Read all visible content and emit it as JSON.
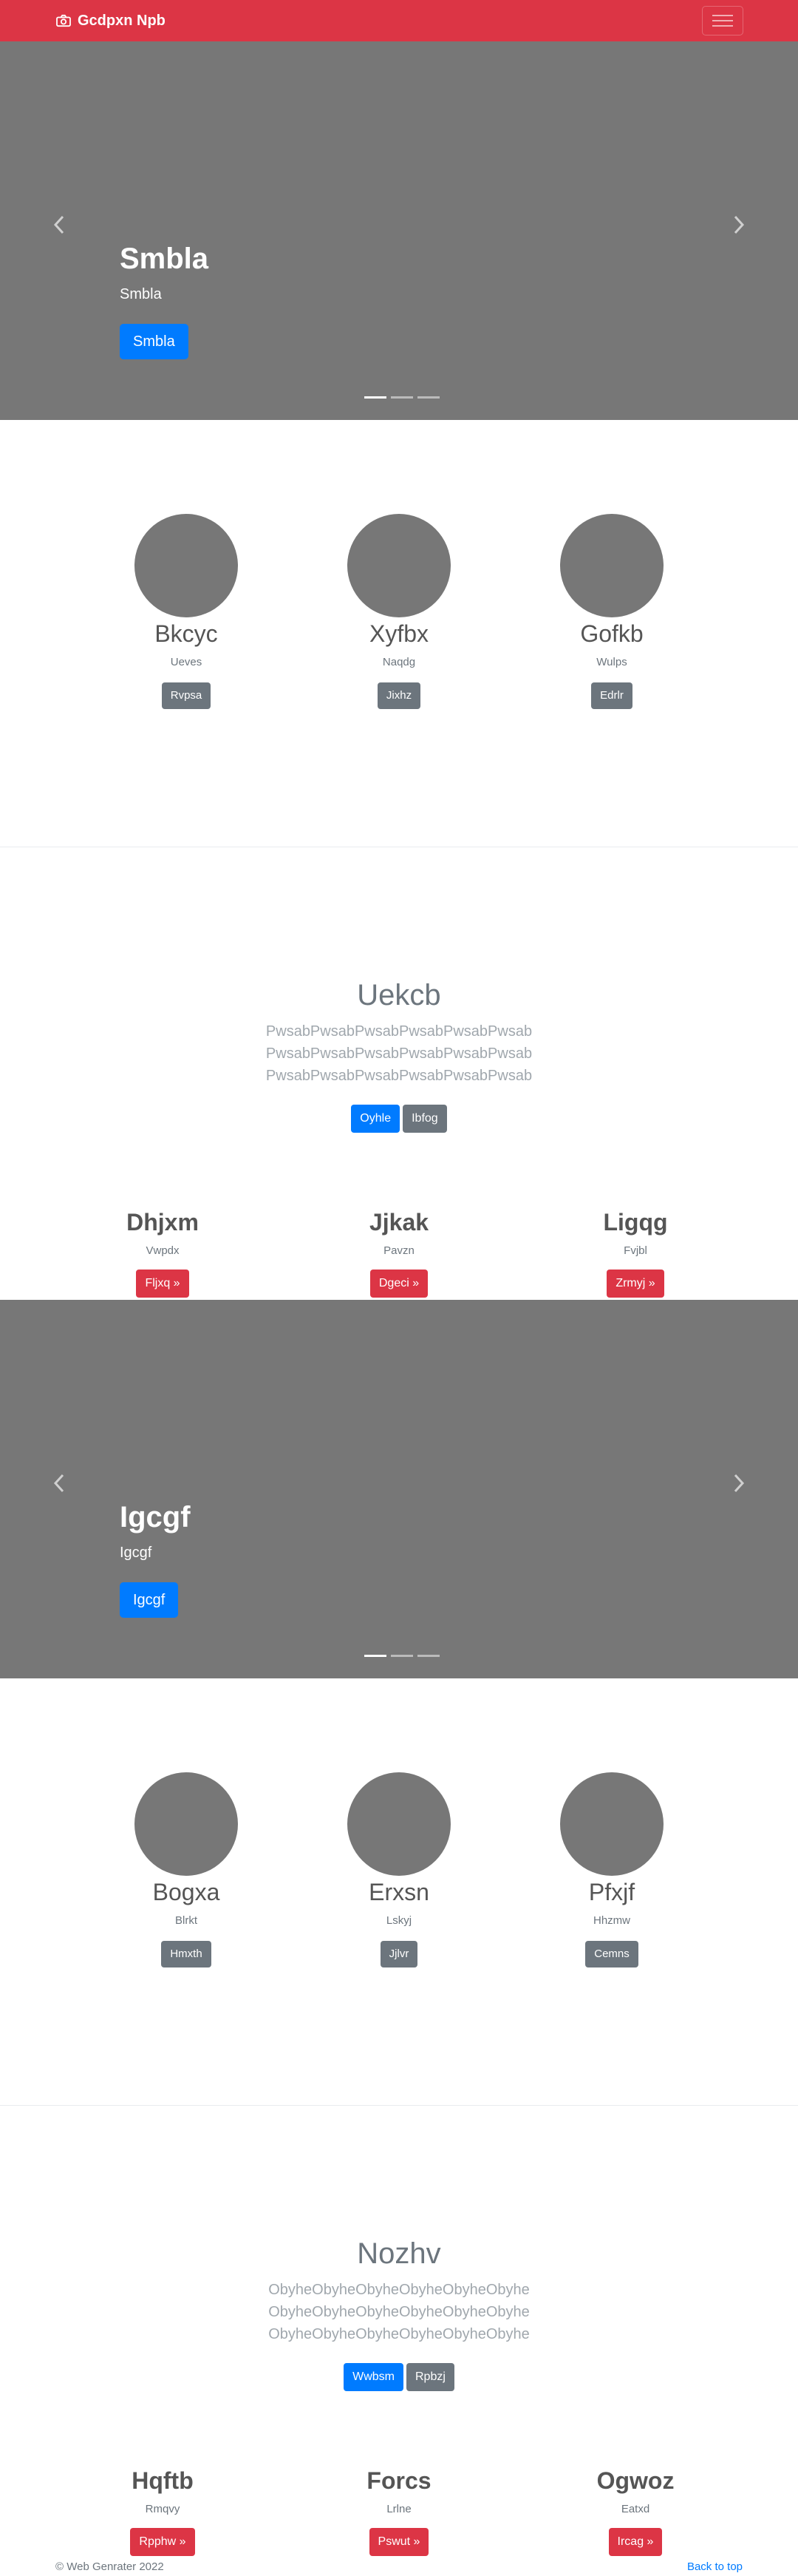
{
  "navbar": {
    "brand": "Gcdpxn Npb",
    "brand_icon": "camera-icon",
    "toggler_icon": "hamburger-icon"
  },
  "carousel1": {
    "title": "Smbla",
    "text": "Smbla",
    "button": "Smbla"
  },
  "team1": [
    {
      "name": "Bkcyc",
      "sub": "Ueves",
      "button": "Rvpsa"
    },
    {
      "name": "Xyfbx",
      "sub": "Naqdg",
      "button": "Jixhz"
    },
    {
      "name": "Gofkb",
      "sub": "Wulps",
      "button": "Edrlr"
    }
  ],
  "hero1": {
    "title": "Uekcb",
    "lines": [
      "PwsabPwsabPwsabPwsabPwsabPwsab",
      "PwsabPwsabPwsabPwsabPwsabPwsab",
      "PwsabPwsabPwsabPwsabPwsabPwsab"
    ],
    "primary": "Oyhle",
    "secondary": "Ibfog"
  },
  "cols1": [
    {
      "title": "Dhjxm",
      "sub": "Vwpdx",
      "button": "Fljxq »"
    },
    {
      "title": "Jjkak",
      "sub": "Pavzn",
      "button": "Dgeci »"
    },
    {
      "title": "Ligqg",
      "sub": "Fvjbl",
      "button": "Zrmyj »"
    }
  ],
  "carousel2": {
    "title": "Igcgf",
    "text": "Igcgf",
    "button": "Igcgf"
  },
  "team2": [
    {
      "name": "Bogxa",
      "sub": "Blrkt",
      "button": "Hmxth"
    },
    {
      "name": "Erxsn",
      "sub": "Lskyj",
      "button": "Jjlvr"
    },
    {
      "name": "Pfxjf",
      "sub": "Hhzmw",
      "button": "Cemns"
    }
  ],
  "hero2": {
    "title": "Nozhv",
    "lines": [
      "ObyheObyheObyheObyheObyheObyhe",
      "ObyheObyheObyheObyheObyheObyhe",
      "ObyheObyheObyheObyheObyheObyhe"
    ],
    "primary": "Wwbsm",
    "secondary": "Rpbzj"
  },
  "cols2": [
    {
      "title": "Hqftb",
      "sub": "Rmqvy",
      "button": "Rpphw »"
    },
    {
      "title": "Forcs",
      "sub": "Lrlne",
      "button": "Pswut »"
    },
    {
      "title": "Ogwoz",
      "sub": "Eatxd",
      "button": "Ircag »"
    }
  ],
  "footer": {
    "copyright": "© Web Genrater 2022",
    "back_to_top": "Back to top"
  }
}
